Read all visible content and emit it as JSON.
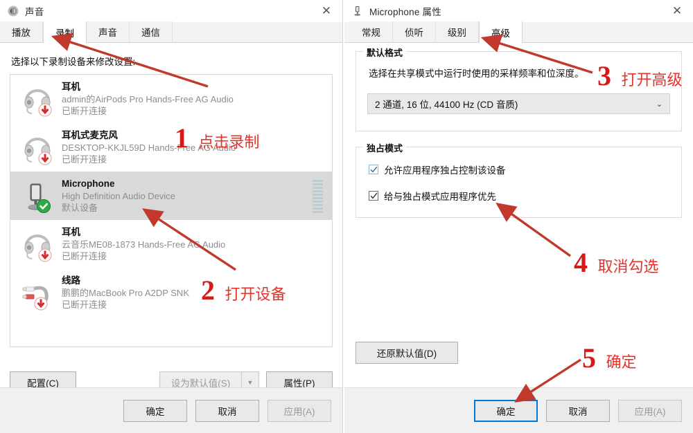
{
  "left_window": {
    "title": "声音",
    "title_icon": "speaker-icon",
    "close_label": "✕",
    "tabs": [
      {
        "label": "播放",
        "active": false
      },
      {
        "label": "录制",
        "active": true
      },
      {
        "label": "声音",
        "active": false
      },
      {
        "label": "通信",
        "active": false
      }
    ],
    "prompt": "选择以下录制设备来修改设置:",
    "devices": [
      {
        "name": "耳机",
        "description": "admin的AirPods Pro Hands-Free AG Audio",
        "status": "已断开连接",
        "icon": "headset-icon",
        "badge": "disconnected-arrow-icon",
        "selected": false
      },
      {
        "name": "耳机式麦克风",
        "description": "DESKTOP-KKJL59D Hands-Free AG Audio",
        "status": "已断开连接",
        "icon": "headset-icon",
        "badge": "disconnected-arrow-icon",
        "selected": false
      },
      {
        "name": "Microphone",
        "description": "High Definition Audio Device",
        "status": "默认设备",
        "icon": "microphone-icon",
        "badge": "default-check-icon",
        "selected": true
      },
      {
        "name": "耳机",
        "description": "云音乐ME08-1873 Hands-Free AG Audio",
        "status": "已断开连接",
        "icon": "headset-icon",
        "badge": "disconnected-arrow-icon",
        "selected": false
      },
      {
        "name": "线路",
        "description": "鹏鹏的MacBook Pro A2DP SNK",
        "status": "已断开连接",
        "icon": "rca-cable-icon",
        "badge": "disconnected-arrow-icon",
        "selected": false
      }
    ],
    "buttons": {
      "configure": "配置(C)",
      "set_default": "设为默认值(S)",
      "properties": "属性(P)"
    },
    "footer": {
      "ok": "确定",
      "cancel": "取消",
      "apply": "应用(A)"
    }
  },
  "right_window": {
    "title": "Microphone 属性",
    "title_icon": "microphone-icon",
    "close_label": "✕",
    "tabs": [
      {
        "label": "常规",
        "active": false
      },
      {
        "label": "侦听",
        "active": false
      },
      {
        "label": "级别",
        "active": false
      },
      {
        "label": "高级",
        "active": true
      }
    ],
    "default_format": {
      "legend": "默认格式",
      "description": "选择在共享模式中运行时使用的采样频率和位深度。",
      "selected_value": "2 通道, 16 位, 44100 Hz (CD 音质)",
      "chevron": "chevron-down-icon"
    },
    "exclusive_mode": {
      "legend": "独占模式",
      "checkboxes": [
        {
          "label": "允许应用程序独占控制该设备",
          "checked": true
        },
        {
          "label": "给与独占模式应用程序优先",
          "checked": true
        }
      ]
    },
    "restore_defaults": "还原默认值(D)",
    "footer": {
      "ok": "确定",
      "cancel": "取消",
      "apply": "应用(A)"
    }
  },
  "annotations": [
    {
      "number": "1",
      "text": "点击录制"
    },
    {
      "number": "2",
      "text": "打开设备"
    },
    {
      "number": "3",
      "text": "打开高级"
    },
    {
      "number": "4",
      "text": "取消勾选"
    },
    {
      "number": "5",
      "text": "确定"
    }
  ],
  "colors": {
    "annotation_red": "#e8312a",
    "annotation_number_red": "#d61a1a",
    "arrow_red": "#c0392b",
    "accent_blue": "#0078d7",
    "selection_gray": "#d9d9d9"
  }
}
